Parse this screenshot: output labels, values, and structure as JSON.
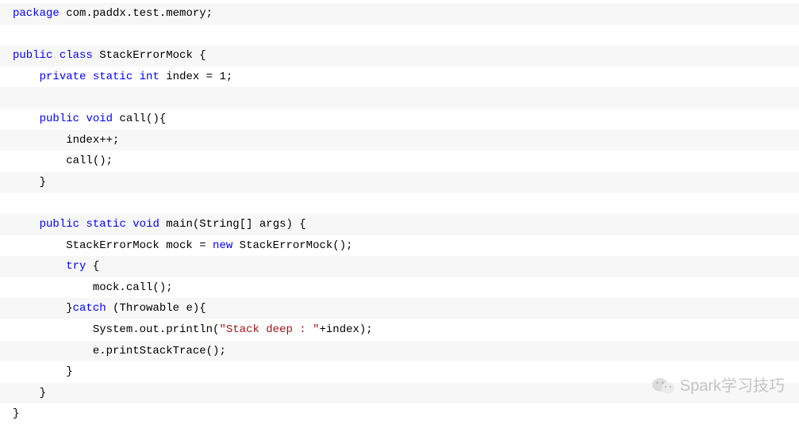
{
  "code": {
    "lines": [
      {
        "c": "odd",
        "tokens": [
          {
            "t": "kw",
            "v": "package"
          },
          {
            "t": "plain",
            "v": " com.paddx.test.memory;"
          }
        ]
      },
      {
        "c": "even",
        "tokens": [
          {
            "t": "plain",
            "v": " "
          }
        ]
      },
      {
        "c": "odd",
        "tokens": [
          {
            "t": "kw",
            "v": "public"
          },
          {
            "t": "plain",
            "v": " "
          },
          {
            "t": "kw",
            "v": "class"
          },
          {
            "t": "plain",
            "v": " StackErrorMock {"
          }
        ]
      },
      {
        "c": "even",
        "tokens": [
          {
            "t": "plain",
            "v": "    "
          },
          {
            "t": "kw",
            "v": "private"
          },
          {
            "t": "plain",
            "v": " "
          },
          {
            "t": "kw",
            "v": "static"
          },
          {
            "t": "plain",
            "v": " "
          },
          {
            "t": "kw",
            "v": "int"
          },
          {
            "t": "plain",
            "v": " index = 1;"
          }
        ]
      },
      {
        "c": "odd",
        "tokens": [
          {
            "t": "plain",
            "v": " "
          }
        ]
      },
      {
        "c": "even",
        "tokens": [
          {
            "t": "plain",
            "v": "    "
          },
          {
            "t": "kw",
            "v": "public"
          },
          {
            "t": "plain",
            "v": " "
          },
          {
            "t": "kw",
            "v": "void"
          },
          {
            "t": "plain",
            "v": " call(){"
          }
        ]
      },
      {
        "c": "odd",
        "tokens": [
          {
            "t": "plain",
            "v": "        index++;"
          }
        ]
      },
      {
        "c": "even",
        "tokens": [
          {
            "t": "plain",
            "v": "        call();"
          }
        ]
      },
      {
        "c": "odd",
        "tokens": [
          {
            "t": "plain",
            "v": "    }"
          }
        ]
      },
      {
        "c": "even",
        "tokens": [
          {
            "t": "plain",
            "v": " "
          }
        ]
      },
      {
        "c": "odd",
        "tokens": [
          {
            "t": "plain",
            "v": "    "
          },
          {
            "t": "kw",
            "v": "public"
          },
          {
            "t": "plain",
            "v": " "
          },
          {
            "t": "kw",
            "v": "static"
          },
          {
            "t": "plain",
            "v": " "
          },
          {
            "t": "kw",
            "v": "void"
          },
          {
            "t": "plain",
            "v": " main(String[] args) {"
          }
        ]
      },
      {
        "c": "even",
        "tokens": [
          {
            "t": "plain",
            "v": "        StackErrorMock mock = "
          },
          {
            "t": "kw",
            "v": "new"
          },
          {
            "t": "plain",
            "v": " StackErrorMock();"
          }
        ]
      },
      {
        "c": "odd",
        "tokens": [
          {
            "t": "plain",
            "v": "        "
          },
          {
            "t": "kw",
            "v": "try"
          },
          {
            "t": "plain",
            "v": " {"
          }
        ]
      },
      {
        "c": "even",
        "tokens": [
          {
            "t": "plain",
            "v": "            mock.call();"
          }
        ]
      },
      {
        "c": "odd",
        "tokens": [
          {
            "t": "plain",
            "v": "        }"
          },
          {
            "t": "kw",
            "v": "catch"
          },
          {
            "t": "plain",
            "v": " (Throwable e){"
          }
        ]
      },
      {
        "c": "even",
        "tokens": [
          {
            "t": "plain",
            "v": "            System.out.println("
          },
          {
            "t": "str",
            "v": "\"Stack deep : \""
          },
          {
            "t": "plain",
            "v": "+index);"
          }
        ]
      },
      {
        "c": "odd",
        "tokens": [
          {
            "t": "plain",
            "v": "            e.printStackTrace();"
          }
        ]
      },
      {
        "c": "even",
        "tokens": [
          {
            "t": "plain",
            "v": "        }"
          }
        ]
      },
      {
        "c": "odd",
        "tokens": [
          {
            "t": "plain",
            "v": "    }"
          }
        ]
      },
      {
        "c": "even",
        "tokens": [
          {
            "t": "plain",
            "v": "}"
          }
        ]
      }
    ]
  },
  "watermark": {
    "text": "Spark学习技巧"
  }
}
